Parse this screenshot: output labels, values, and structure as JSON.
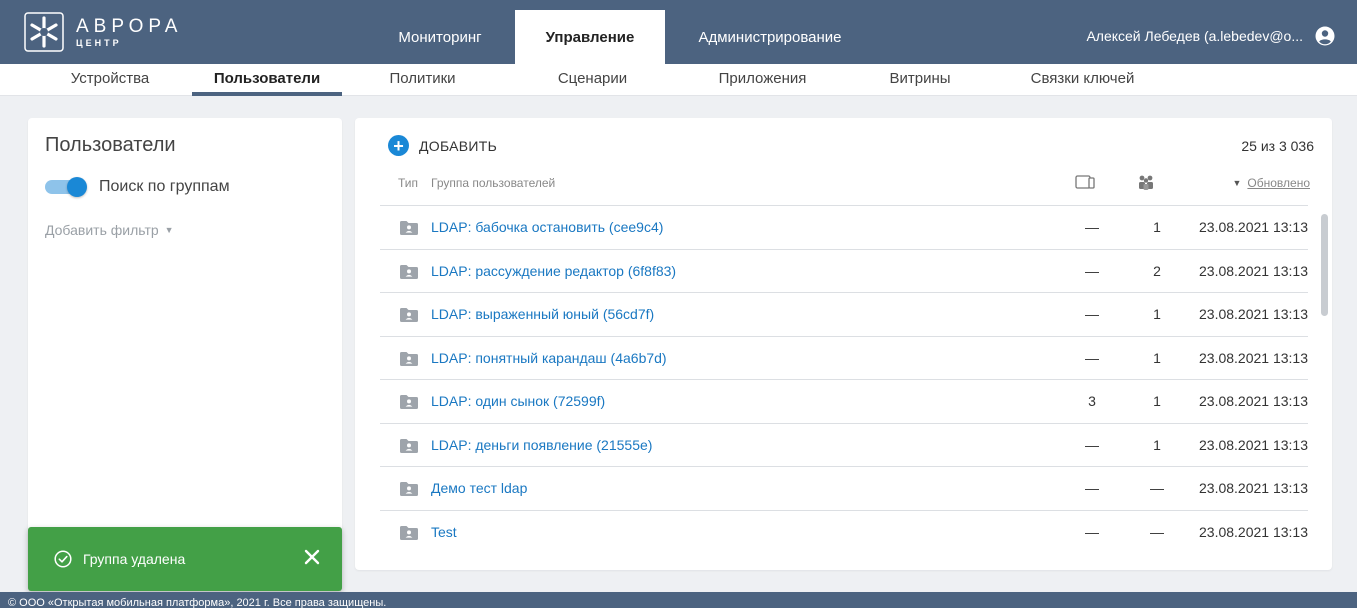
{
  "brand": {
    "title": "АВРОРА",
    "subtitle": "ЦЕНТР"
  },
  "main_nav": [
    {
      "label": "Мониторинг",
      "active": false
    },
    {
      "label": "Управление",
      "active": true
    },
    {
      "label": "Администрирование",
      "active": false
    }
  ],
  "user": {
    "name": "Алексей Лебедев (a.lebedev@o...",
    "icon": "account-circle-icon"
  },
  "sub_nav": [
    {
      "label": "Устройства",
      "active": false
    },
    {
      "label": "Пользователи",
      "active": true
    },
    {
      "label": "Политики",
      "active": false
    },
    {
      "label": "Сценарии",
      "active": false
    },
    {
      "label": "Приложения",
      "active": false
    },
    {
      "label": "Витрины",
      "active": false
    },
    {
      "label": "Связки ключей",
      "active": false
    }
  ],
  "sidebar": {
    "title": "Пользователи",
    "toggle_label": "Поиск по группам",
    "toggle_on": true,
    "add_filter": "Добавить фильтр"
  },
  "list": {
    "add_label": "ДОБАВИТЬ",
    "count": "25 из 3 036",
    "headers": {
      "type": "Тип",
      "group": "Группа пользователей",
      "updated": "Обновлено"
    },
    "rows": [
      {
        "name": "LDAP: бабочка остановить (cee9c4)",
        "devices": "—",
        "members": "1",
        "updated": "23.08.2021 13:13"
      },
      {
        "name": "LDAP: рассуждение редактор (6f8f83)",
        "devices": "—",
        "members": "2",
        "updated": "23.08.2021 13:13"
      },
      {
        "name": "LDAP: выраженный юный (56cd7f)",
        "devices": "—",
        "members": "1",
        "updated": "23.08.2021 13:13"
      },
      {
        "name": "LDAP: понятный карандаш (4a6b7d)",
        "devices": "—",
        "members": "1",
        "updated": "23.08.2021 13:13"
      },
      {
        "name": "LDAP: один сынок (72599f)",
        "devices": "3",
        "members": "1",
        "updated": "23.08.2021 13:13"
      },
      {
        "name": "LDAP: деньги появление (21555e)",
        "devices": "—",
        "members": "1",
        "updated": "23.08.2021 13:13"
      },
      {
        "name": "Демо тест ldap",
        "devices": "—",
        "members": "—",
        "updated": "23.08.2021 13:13"
      },
      {
        "name": "Test",
        "devices": "—",
        "members": "—",
        "updated": "23.08.2021 13:13"
      }
    ]
  },
  "toast": {
    "message": "Группа удалена",
    "color": "#43a047"
  },
  "footer": {
    "text": "© ООО «Открытая мобильная платформа», 2021 г. Все права защищены."
  },
  "colors": {
    "header": "#4c6380",
    "accent": "#1a88d6",
    "link": "#1a78c2"
  }
}
